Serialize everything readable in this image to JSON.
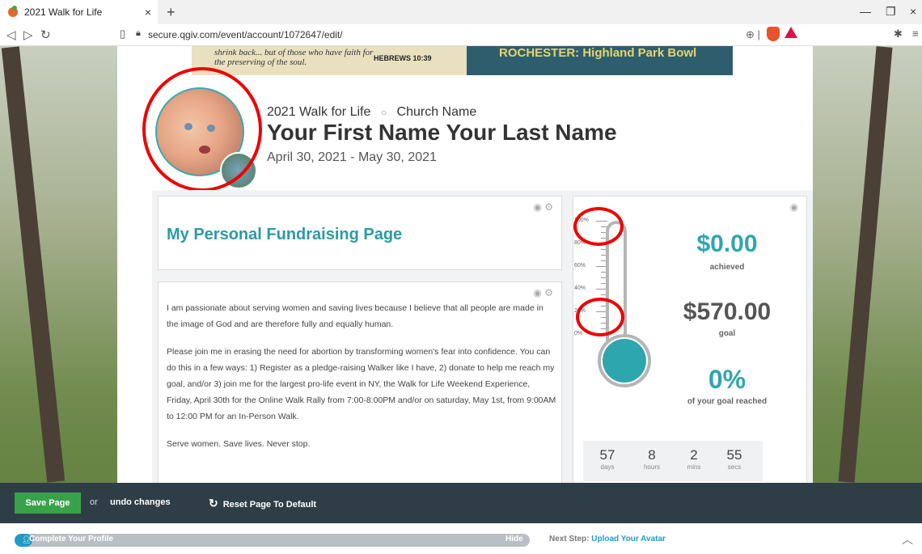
{
  "browser": {
    "tab_title": "2021 Walk for Life",
    "url": "secure.qgiv.com/event/account/1072647/edit/"
  },
  "banner": {
    "verse": "shrink back... but of those who have faith for the preserving of the soul.",
    "reference": "HEBREWS 10:39",
    "location": "ROCHESTER: Highland Park Bowl"
  },
  "header": {
    "event": "2021 Walk for Life",
    "church": "Church Name",
    "name": "Your First Name Your Last Name",
    "dates": "April 30, 2021 - May 30, 2021"
  },
  "title_card": {
    "heading": "My Personal Fundraising Page"
  },
  "body_card": {
    "p1": "I am passionate about serving women and saving lives because I believe that all people are made in the image of God and are therefore fully and equally human.",
    "p2": "Please join me in erasing the need for abortion by transforming women's fear into confidence. You can do this in a few ways: 1) Register as a pledge-raising Walker like I have, 2) donate to help me reach my goal, and/or 3) join me for the largest pro-life event in NY, the Walk for Life Weekend Experience, Friday, April 30th for the Online Walk Rally from 7:00-8:00PM and/or on saturday, May 1st, from 9:00AM to 12:00 PM for an In-Person Walk.",
    "p3": "Serve women. Save lives. Never stop."
  },
  "thermometer": {
    "ticks": [
      "100%",
      "80%",
      "60%",
      "40%",
      "20%",
      "0%"
    ],
    "achieved_amount": "$0.00",
    "achieved_label": "achieved",
    "goal_amount": "$570.00",
    "goal_label": "goal",
    "percent": "0%",
    "percent_label": "of your goal reached",
    "accent_color": "#2ea6ae"
  },
  "countdown": [
    {
      "value": "57",
      "unit": "days"
    },
    {
      "value": "8",
      "unit": "hours"
    },
    {
      "value": "2",
      "unit": "mins"
    },
    {
      "value": "55",
      "unit": "secs"
    }
  ],
  "toolbar": {
    "save_label": "Save Page",
    "or_label": "or",
    "undo_label": "undo changes",
    "reset_label": "Reset Page To Default"
  },
  "footer": {
    "profile_label": "Complete Your Profile",
    "hide_label": "Hide",
    "next_step_prefix": "Next Step:",
    "next_step_link": "Upload Your Avatar"
  },
  "icons": [
    "favicon-icon",
    "close-icon",
    "plus-icon",
    "back-icon",
    "forward-icon",
    "reload-icon",
    "bookmark-icon",
    "lock-icon",
    "zoom-icon",
    "brave-icon",
    "bat-icon",
    "extensions-icon",
    "eye-icon",
    "gear-icon",
    "reset-icon",
    "user-icon",
    "chevron-up-icon"
  ]
}
